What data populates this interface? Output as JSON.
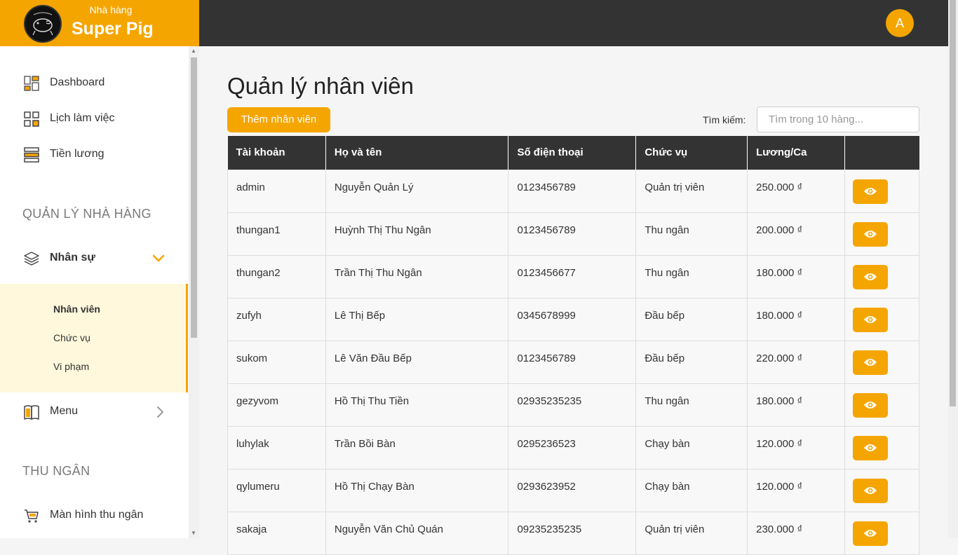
{
  "brand": {
    "subtitle": "Nhà hàng",
    "name": "Super Pig"
  },
  "topbar": {
    "avatar_initial": "A"
  },
  "sidebar": {
    "items_top": [
      {
        "label": "Dashboard",
        "icon": "dashboard-icon"
      },
      {
        "label": "Lịch làm việc",
        "icon": "calendar-grid-icon"
      },
      {
        "label": "Tiền lương",
        "icon": "salary-icon"
      }
    ],
    "section_manage": "QUẢN LÝ NHÀ HÀNG",
    "hr": {
      "label": "Nhân sự",
      "icon": "layers-icon"
    },
    "hr_sub": [
      {
        "label": "Nhân viên",
        "active": true
      },
      {
        "label": "Chức vụ"
      },
      {
        "label": "Vi phạm"
      }
    ],
    "menu": {
      "label": "Menu",
      "icon": "book-icon"
    },
    "section_cashier": "THU NGÂN",
    "cashier_screen": {
      "label": "Màn hình thu ngân",
      "icon": "cart-icon"
    }
  },
  "main": {
    "title": "Quản lý nhân viên",
    "add_button": "Thêm nhân viên",
    "search_label": "Tìm kiếm:",
    "search_placeholder": "Tìm trong 10 hàng...",
    "columns": [
      "Tài khoản",
      "Họ và tên",
      "Số điện thoại",
      "Chức vụ",
      "Lương/Ca",
      ""
    ],
    "rows": [
      [
        "admin",
        "Nguyễn Quản Lý",
        "0123456789",
        "Quản trị viên",
        "250.000 ₫"
      ],
      [
        "thungan1",
        "Huỳnh Thị Thu Ngân",
        "0123456789",
        "Thu ngân",
        "200.000 ₫"
      ],
      [
        "thungan2",
        "Trần Thị Thu Ngân",
        "0123456677",
        "Thu ngân",
        "180.000 ₫"
      ],
      [
        "zufyh",
        "Lê Thị Bếp",
        "0345678999",
        "Đầu bếp",
        "180.000 ₫"
      ],
      [
        "sukom",
        "Lê Văn Đầu Bếp",
        "0123456789",
        "Đầu bếp",
        "220.000 ₫"
      ],
      [
        "gezyvom",
        "Hồ Thị Thu Tiền",
        "02935235235",
        "Thu ngân",
        "180.000 ₫"
      ],
      [
        "luhylak",
        "Trần Bồi Bàn",
        "0295236523",
        "Chạy bàn",
        "120.000 ₫"
      ],
      [
        "qylumeru",
        "Hồ Thị Chạy Bàn",
        "0293623952",
        "Chạy bàn",
        "120.000 ₫"
      ],
      [
        "sakaja",
        "Nguyễn Văn Chủ Quán",
        "09235235235",
        "Quản trị viên",
        "230.000 ₫"
      ]
    ]
  },
  "colors": {
    "accent": "#f5a500",
    "topbar": "#333333",
    "submenu_bg": "#fff8dc"
  }
}
